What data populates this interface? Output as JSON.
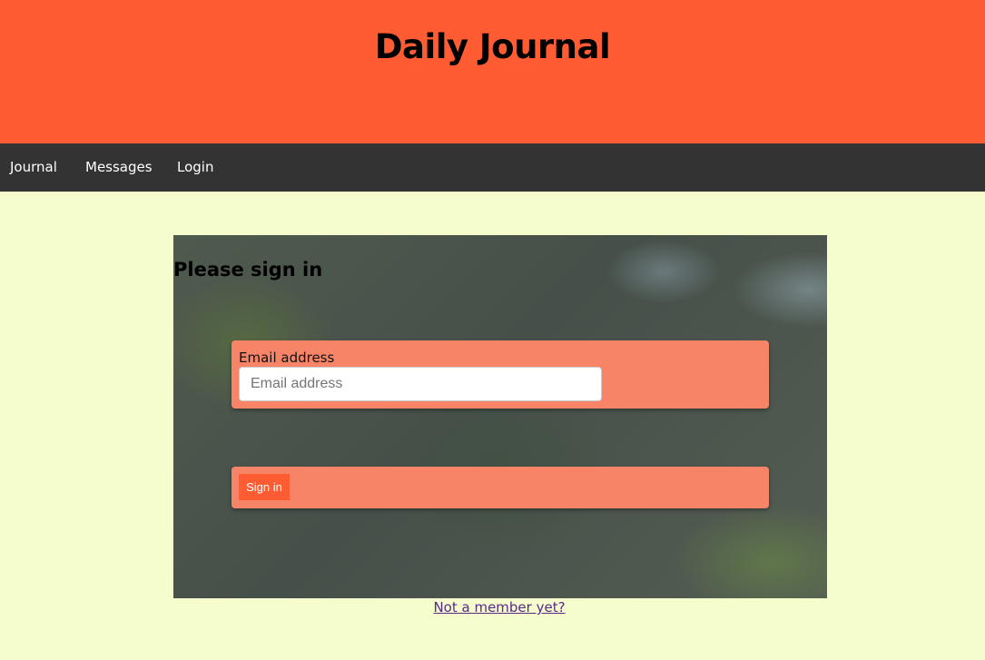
{
  "header": {
    "title": "Daily Journal",
    "background_color": "#ff5c33"
  },
  "nav": {
    "items": [
      {
        "label": "Journal"
      },
      {
        "label": "Messages"
      },
      {
        "label": "Login"
      }
    ],
    "background_color": "#333333"
  },
  "signin": {
    "heading": "Please sign in",
    "email_label": "Email address",
    "email_placeholder": "Email address",
    "email_value": "",
    "button_label": "Sign in",
    "card_color": "#f88468",
    "button_color": "#ff5c33"
  },
  "footer_link": {
    "label": "Not a member yet?"
  },
  "page": {
    "background_color": "#f4fdcb"
  }
}
